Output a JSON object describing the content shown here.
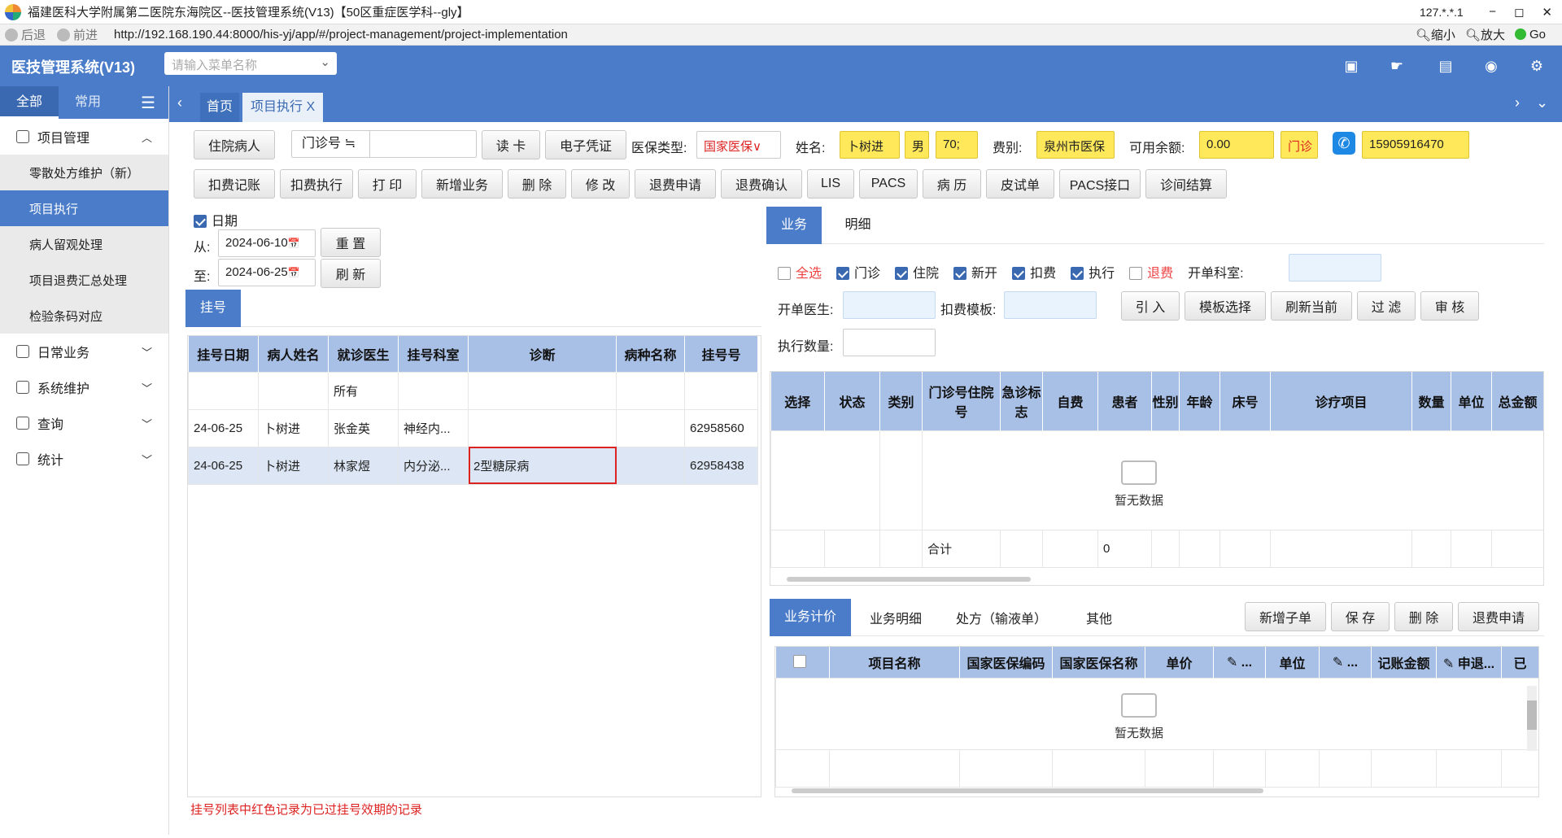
{
  "window": {
    "title": "福建医科大学附属第二医院东海院区--医技管理系统(V13)【50区重症医学科--gly】",
    "ip": "127.*.*.1",
    "controls": [
      "−",
      "◻",
      "✕"
    ]
  },
  "addressbar": {
    "back": "后退",
    "forward": "前进",
    "url": "http://192.168.190.44:8000/his-yj/app/#/project-management/project-implementation",
    "zoom_out": "缩小",
    "zoom_in": "放大",
    "go": "Go"
  },
  "header": {
    "app_name": "医技管理系统(V13)",
    "menu_search_placeholder": "请输入菜单名称"
  },
  "sidebar": {
    "tab_all": "全部",
    "tab_common": "常用",
    "groups": [
      {
        "label": "项目管理",
        "expanded": true,
        "items": [
          "零散处方维护（新）",
          "项目执行",
          "病人留观处理",
          "项目退费汇总处理",
          "检验条码对应"
        ]
      },
      {
        "label": "日常业务"
      },
      {
        "label": "系统维护"
      },
      {
        "label": "查询"
      },
      {
        "label": "统计"
      }
    ]
  },
  "tabs": {
    "home": "首页",
    "current": "项目执行 X"
  },
  "toolbar1": {
    "inpatient": "住院病人",
    "outpatient_no": "门诊号 ≒",
    "read_card": "读 卡",
    "e_voucher": "电子凭证",
    "insurance_type_label": "医保类型:",
    "insurance_type": "国家医保∨",
    "name_label": "姓名:",
    "name": "卜树进",
    "gender": "男",
    "age": "70;",
    "fee_label": "费别:",
    "fee": "泉州市医保",
    "balance_label": "可用余额:",
    "balance": "0.00",
    "door": "门诊",
    "phone": "15905916470"
  },
  "toolbar2": [
    "扣费记账",
    "扣费执行",
    "打 印",
    "新增业务",
    "删 除",
    "修 改",
    "退费申请",
    "退费确认",
    "LIS",
    "PACS",
    "病 历",
    "皮试单",
    "PACS接口",
    "诊间结算"
  ],
  "filter": {
    "date_label": "日期",
    "from_label": "从:",
    "from": "2024-06-10",
    "to_label": "至:",
    "to": "2024-06-25",
    "reset": "重 置",
    "refresh": "刷 新"
  },
  "reg_tab": "挂号",
  "reg_table": {
    "headers": [
      "挂号日期",
      "病人姓名",
      "就诊医生",
      "挂号科室",
      "诊断",
      "病种名称",
      "挂号号"
    ],
    "rows": [
      [
        "",
        "",
        "所有",
        "",
        "",
        "",
        ""
      ],
      [
        "24-06-25",
        "卜树进",
        "张金英",
        "神经内...",
        "",
        "",
        "62958560"
      ],
      [
        "24-06-25",
        "卜树进",
        "林家煜",
        "内分泌...",
        "2型糖尿病",
        "",
        "62958438"
      ]
    ]
  },
  "footer_note": "挂号列表中红色记录为已过挂号效期的记录",
  "right_tabs": {
    "business": "业务",
    "detail": "明细"
  },
  "checks": {
    "all": "全选",
    "outpatient": "门诊",
    "inpatient": "住院",
    "new": "新开",
    "deduct": "扣费",
    "execute": "执行",
    "refund": "退费",
    "dept_label": "开单科室:"
  },
  "row2": {
    "doctor_label": "开单医生:",
    "template_label": "扣费模板:",
    "import": "引 入",
    "template_select": "模板选择",
    "refresh_current": "刷新当前",
    "filter": "过 滤",
    "audit": "审 核",
    "exec_qty_label": "执行数量:"
  },
  "exec_table": {
    "headers": [
      "选择",
      "状态",
      "类别",
      "门诊号住院号",
      "急诊标志",
      "自费",
      "患者",
      "性别",
      "年龄",
      "床号",
      "诊疗项目",
      "数量",
      "单位",
      "总金额"
    ],
    "empty": "暂无数据",
    "total_label": "合计",
    "total_value": "0"
  },
  "bottom_tabs": [
    "业务计价",
    "业务明细",
    "处方（输液单）",
    "其他"
  ],
  "bottom_btns": [
    "新增子单",
    "保 存",
    "删 除",
    "退费申请"
  ],
  "bill_table": {
    "headers": [
      "",
      "项目名称",
      "国家医保编码",
      "国家医保名称",
      "单价",
      "✎ ...",
      "单位",
      "✎ ...",
      "记账金额",
      "✎ 申退...",
      "已"
    ],
    "empty": "暂无数据"
  }
}
